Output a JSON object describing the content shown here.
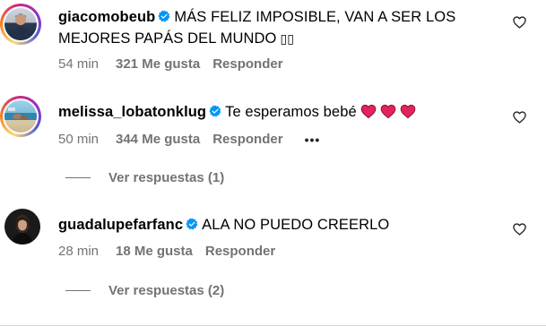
{
  "comments": [
    {
      "username": "giacomobeub",
      "text_line1": "MÁS FELIZ IMPOSIBLE, VAN A SER LOS",
      "text_line2": "MEJORES PAPÁS DEL MUNDO",
      "text_suffix": "▯▯",
      "time": "54 min",
      "likes": "321 Me gusta",
      "reply": "Responder",
      "avatar_ring": true
    },
    {
      "username": "melissa_lobatonklug",
      "text": "Te esperamos bebé",
      "hearts": 3,
      "time": "50 min",
      "likes": "344 Me gusta",
      "reply": "Responder",
      "more": "•••",
      "view_replies": "Ver respuestas (1)",
      "avatar_ring": true
    },
    {
      "username": "guadalupefarfanc",
      "text": "ALA NO PUEDO CREERLO",
      "time": "28 min",
      "likes": "18 Me gusta",
      "reply": "Responder",
      "view_replies": "Ver respuestas (2)",
      "avatar_ring": false
    }
  ],
  "colors": {
    "verified": "#0095f6",
    "meta_text": "#737373",
    "heart_red": "#e0245e"
  },
  "icons": {
    "like": "heart-outline-icon",
    "verified": "verified-badge-icon",
    "emoji": "red-heart-emoji"
  }
}
